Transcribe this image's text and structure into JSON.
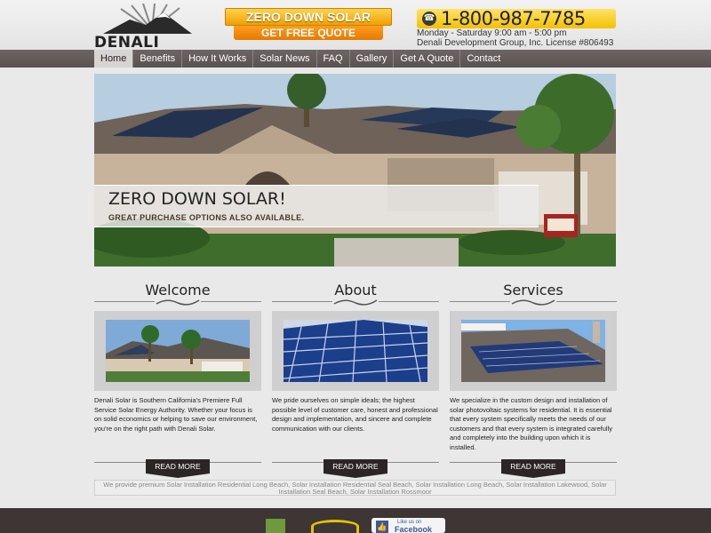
{
  "header": {
    "logo_text": "DENALI SOLAR",
    "promo_top": "ZERO DOWN SOLAR",
    "promo_bottom": "GET FREE QUOTE",
    "phone": "1-800-987-7785",
    "hours": "Monday - Saturday 9:00 am - 5:00 pm",
    "license": "Denali Development Group, Inc. License #806493"
  },
  "nav": {
    "items": [
      "Home",
      "Benefits",
      "How It Works",
      "Solar News",
      "FAQ",
      "Gallery",
      "Get A Quote",
      "Contact"
    ],
    "active": "Home"
  },
  "hero": {
    "title": "ZERO DOWN SOLAR!",
    "subtitle": "GREAT PURCHASE OPTIONS ALSO AVAILABLE."
  },
  "columns": [
    {
      "title": "Welcome",
      "text": "Denali Solar is Southern California's Premiere Full Service Solar Energy Authority. Whether your focus is on solid economics or helping to save our environment, you're on the right path with Denali Solar.",
      "button": "READ MORE"
    },
    {
      "title": "About",
      "text": "We pride ourselves on simple ideals; the highest possible level of customer care, honest and professional design and implementation, and sincere and complete communication with our clients.",
      "button": "READ MORE"
    },
    {
      "title": "Services",
      "text": "We specialize in the custom design and installation of solar photovoltaic systems for residential. It is essential that every system specifically meets the needs of our customers and that every system is integrated carefully and completely into the building upon which it is installed.",
      "button": "READ MORE"
    }
  ],
  "keywords": "We provide premium Solar Installation Residential Long Beach, Solar Installation Residential Seal Beach, Solar Installation Long Beach, Solar Installation Lakewood, Solar Installation Seal Beach, Solar Installation Rossmoor",
  "footer": {
    "facebook_small": "Like us on",
    "facebook_big": "Facebook"
  },
  "icons": {
    "phone": "phone-icon",
    "facebook": "facebook-thumb-icon"
  },
  "colors": {
    "nav_bg": "#5f5656",
    "promo": "#f0a000",
    "phone_box": "#f2c100",
    "footer_bg": "#3e3535"
  }
}
